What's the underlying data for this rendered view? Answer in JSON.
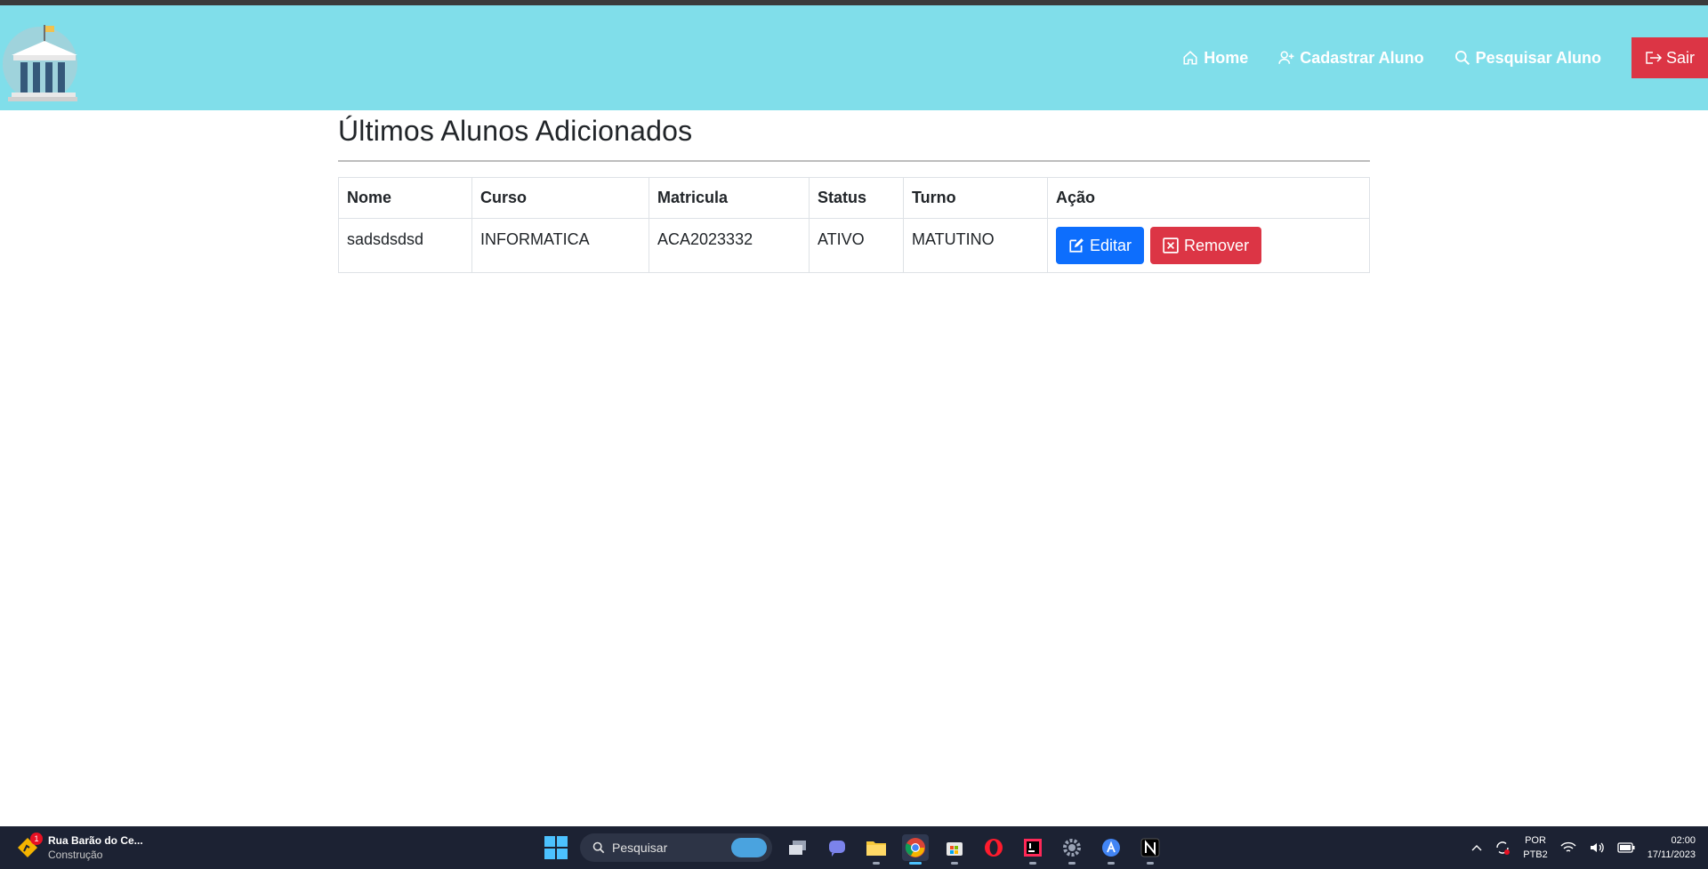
{
  "navbar": {
    "logo_alt": "bank-building-logo",
    "links": [
      {
        "label": "Home",
        "icon": "house-icon"
      },
      {
        "label": "Cadastrar Aluno",
        "icon": "person-add-icon"
      },
      {
        "label": "Pesquisar Aluno",
        "icon": "search-icon"
      }
    ],
    "logout_label": "Sair",
    "colors": {
      "navbar_bg": "#80deea",
      "logout_bg": "#dc3545"
    }
  },
  "main": {
    "title": "Últimos Alunos Adicionados",
    "table": {
      "headers": [
        "Nome",
        "Curso",
        "Matricula",
        "Status",
        "Turno",
        "Ação"
      ],
      "rows": [
        {
          "nome": "sadsdsdsd",
          "curso": "INFORMATICA",
          "matricula": "ACA2023332",
          "status": "ATIVO",
          "turno": "MATUTINO"
        }
      ],
      "edit_label": "Editar",
      "remove_label": "Remover"
    }
  },
  "taskbar": {
    "weather_title": "Rua Barão do Ce...",
    "weather_subtitle": "Construção",
    "weather_badge": "1",
    "search_placeholder": "Pesquisar",
    "lang_top": "POR",
    "lang_bottom": "PTB2",
    "time": "02:00",
    "date": "17/11/2023"
  }
}
